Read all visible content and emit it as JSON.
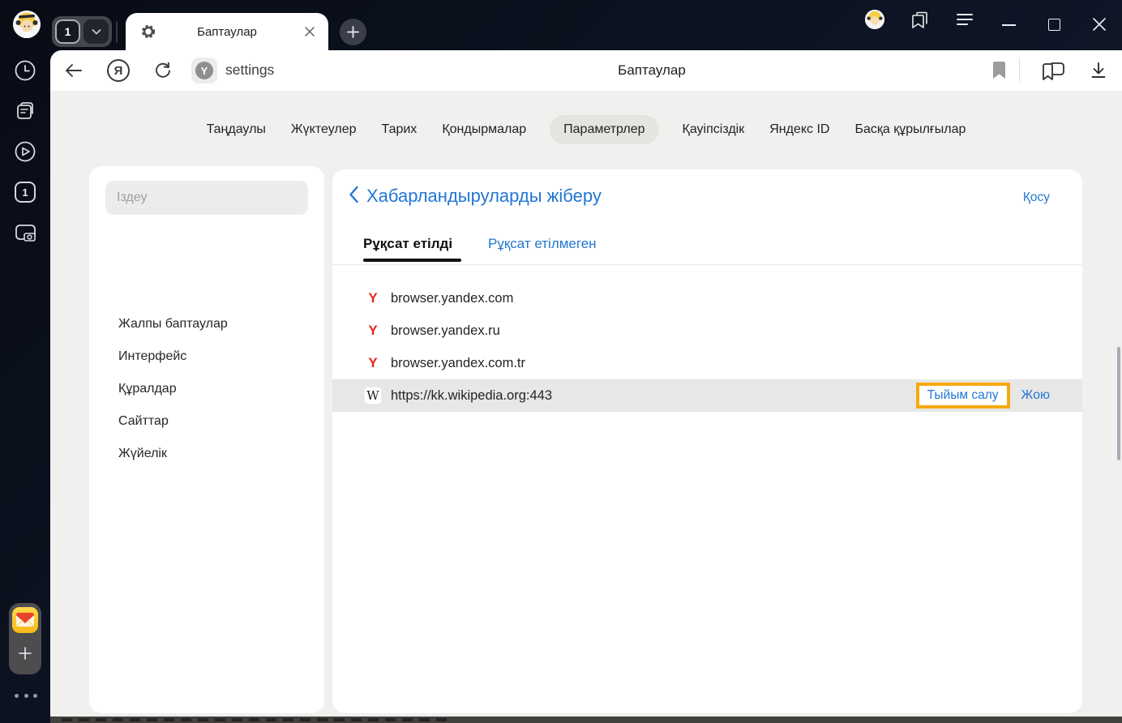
{
  "browser": {
    "tab_group": {
      "count": "1"
    },
    "tab": {
      "title": "Баптаулар"
    },
    "toolbar": {
      "url": "settings",
      "title": "Баптаулар",
      "logo_glyph": "Я",
      "badge_glyph": "Y"
    }
  },
  "vertical_sidebar": {
    "tab_count": "1"
  },
  "nav": {
    "tabs": [
      {
        "label": "Таңдаулы",
        "active": false
      },
      {
        "label": "Жүктеулер",
        "active": false
      },
      {
        "label": "Тарих",
        "active": false
      },
      {
        "label": "Қондырмалар",
        "active": false
      },
      {
        "label": "Параметрлер",
        "active": true
      },
      {
        "label": "Қауіпсіздік",
        "active": false
      },
      {
        "label": "Яндекс ID",
        "active": false
      },
      {
        "label": "Басқа құрылғылар",
        "active": false
      }
    ]
  },
  "settings_nav": {
    "search_placeholder": "Іздеу",
    "items": [
      {
        "label": "Жалпы баптаулар"
      },
      {
        "label": "Интерфейс"
      },
      {
        "label": "Құралдар"
      },
      {
        "label": "Сайттар"
      },
      {
        "label": "Жүйелік"
      }
    ]
  },
  "notifications": {
    "title": "Хабарландыруларды жіберу",
    "add_label": "Қосу",
    "tabs": [
      {
        "label": "Рұқсат етілді",
        "active": true
      },
      {
        "label": "Рұқсат етілмеген",
        "active": false
      }
    ],
    "sites": [
      {
        "favicon": "yandex-icon",
        "glyph": "Y",
        "url": "browser.yandex.com",
        "highlighted": false
      },
      {
        "favicon": "yandex-icon",
        "glyph": "Y",
        "url": "browser.yandex.ru",
        "highlighted": false
      },
      {
        "favicon": "yandex-icon",
        "glyph": "Y",
        "url": "browser.yandex.com.tr",
        "highlighted": false
      },
      {
        "favicon": "wikipedia-icon",
        "glyph": "W",
        "url": "https://kk.wikipedia.org:443",
        "highlighted": true,
        "block_label": "Тыйым салу",
        "delete_label": "Жою"
      }
    ]
  },
  "colors": {
    "accent_blue": "#2377d4",
    "annotation_yellow": "#f7a912",
    "yandex_red": "#e3261d",
    "highlight_row": "#e7e7e6",
    "chrome_dark": "#0d1322",
    "page_bg": "#f1f0ee"
  }
}
